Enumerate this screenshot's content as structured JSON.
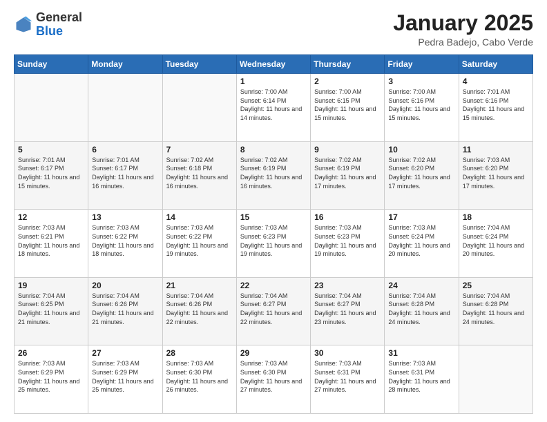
{
  "header": {
    "logo_general": "General",
    "logo_blue": "Blue",
    "month_title": "January 2025",
    "location": "Pedra Badejo, Cabo Verde"
  },
  "weekdays": [
    "Sunday",
    "Monday",
    "Tuesday",
    "Wednesday",
    "Thursday",
    "Friday",
    "Saturday"
  ],
  "weeks": [
    [
      {
        "day": "",
        "info": ""
      },
      {
        "day": "",
        "info": ""
      },
      {
        "day": "",
        "info": ""
      },
      {
        "day": "1",
        "info": "Sunrise: 7:00 AM\nSunset: 6:14 PM\nDaylight: 11 hours\nand 14 minutes."
      },
      {
        "day": "2",
        "info": "Sunrise: 7:00 AM\nSunset: 6:15 PM\nDaylight: 11 hours\nand 15 minutes."
      },
      {
        "day": "3",
        "info": "Sunrise: 7:00 AM\nSunset: 6:16 PM\nDaylight: 11 hours\nand 15 minutes."
      },
      {
        "day": "4",
        "info": "Sunrise: 7:01 AM\nSunset: 6:16 PM\nDaylight: 11 hours\nand 15 minutes."
      }
    ],
    [
      {
        "day": "5",
        "info": "Sunrise: 7:01 AM\nSunset: 6:17 PM\nDaylight: 11 hours\nand 15 minutes."
      },
      {
        "day": "6",
        "info": "Sunrise: 7:01 AM\nSunset: 6:17 PM\nDaylight: 11 hours\nand 16 minutes."
      },
      {
        "day": "7",
        "info": "Sunrise: 7:02 AM\nSunset: 6:18 PM\nDaylight: 11 hours\nand 16 minutes."
      },
      {
        "day": "8",
        "info": "Sunrise: 7:02 AM\nSunset: 6:19 PM\nDaylight: 11 hours\nand 16 minutes."
      },
      {
        "day": "9",
        "info": "Sunrise: 7:02 AM\nSunset: 6:19 PM\nDaylight: 11 hours\nand 17 minutes."
      },
      {
        "day": "10",
        "info": "Sunrise: 7:02 AM\nSunset: 6:20 PM\nDaylight: 11 hours\nand 17 minutes."
      },
      {
        "day": "11",
        "info": "Sunrise: 7:03 AM\nSunset: 6:20 PM\nDaylight: 11 hours\nand 17 minutes."
      }
    ],
    [
      {
        "day": "12",
        "info": "Sunrise: 7:03 AM\nSunset: 6:21 PM\nDaylight: 11 hours\nand 18 minutes."
      },
      {
        "day": "13",
        "info": "Sunrise: 7:03 AM\nSunset: 6:22 PM\nDaylight: 11 hours\nand 18 minutes."
      },
      {
        "day": "14",
        "info": "Sunrise: 7:03 AM\nSunset: 6:22 PM\nDaylight: 11 hours\nand 19 minutes."
      },
      {
        "day": "15",
        "info": "Sunrise: 7:03 AM\nSunset: 6:23 PM\nDaylight: 11 hours\nand 19 minutes."
      },
      {
        "day": "16",
        "info": "Sunrise: 7:03 AM\nSunset: 6:23 PM\nDaylight: 11 hours\nand 19 minutes."
      },
      {
        "day": "17",
        "info": "Sunrise: 7:03 AM\nSunset: 6:24 PM\nDaylight: 11 hours\nand 20 minutes."
      },
      {
        "day": "18",
        "info": "Sunrise: 7:04 AM\nSunset: 6:24 PM\nDaylight: 11 hours\nand 20 minutes."
      }
    ],
    [
      {
        "day": "19",
        "info": "Sunrise: 7:04 AM\nSunset: 6:25 PM\nDaylight: 11 hours\nand 21 minutes."
      },
      {
        "day": "20",
        "info": "Sunrise: 7:04 AM\nSunset: 6:26 PM\nDaylight: 11 hours\nand 21 minutes."
      },
      {
        "day": "21",
        "info": "Sunrise: 7:04 AM\nSunset: 6:26 PM\nDaylight: 11 hours\nand 22 minutes."
      },
      {
        "day": "22",
        "info": "Sunrise: 7:04 AM\nSunset: 6:27 PM\nDaylight: 11 hours\nand 22 minutes."
      },
      {
        "day": "23",
        "info": "Sunrise: 7:04 AM\nSunset: 6:27 PM\nDaylight: 11 hours\nand 23 minutes."
      },
      {
        "day": "24",
        "info": "Sunrise: 7:04 AM\nSunset: 6:28 PM\nDaylight: 11 hours\nand 24 minutes."
      },
      {
        "day": "25",
        "info": "Sunrise: 7:04 AM\nSunset: 6:28 PM\nDaylight: 11 hours\nand 24 minutes."
      }
    ],
    [
      {
        "day": "26",
        "info": "Sunrise: 7:03 AM\nSunset: 6:29 PM\nDaylight: 11 hours\nand 25 minutes."
      },
      {
        "day": "27",
        "info": "Sunrise: 7:03 AM\nSunset: 6:29 PM\nDaylight: 11 hours\nand 25 minutes."
      },
      {
        "day": "28",
        "info": "Sunrise: 7:03 AM\nSunset: 6:30 PM\nDaylight: 11 hours\nand 26 minutes."
      },
      {
        "day": "29",
        "info": "Sunrise: 7:03 AM\nSunset: 6:30 PM\nDaylight: 11 hours\nand 27 minutes."
      },
      {
        "day": "30",
        "info": "Sunrise: 7:03 AM\nSunset: 6:31 PM\nDaylight: 11 hours\nand 27 minutes."
      },
      {
        "day": "31",
        "info": "Sunrise: 7:03 AM\nSunset: 6:31 PM\nDaylight: 11 hours\nand 28 minutes."
      },
      {
        "day": "",
        "info": ""
      }
    ]
  ],
  "colors": {
    "header_bg": "#2a6db5",
    "accent": "#1a6ec7"
  }
}
